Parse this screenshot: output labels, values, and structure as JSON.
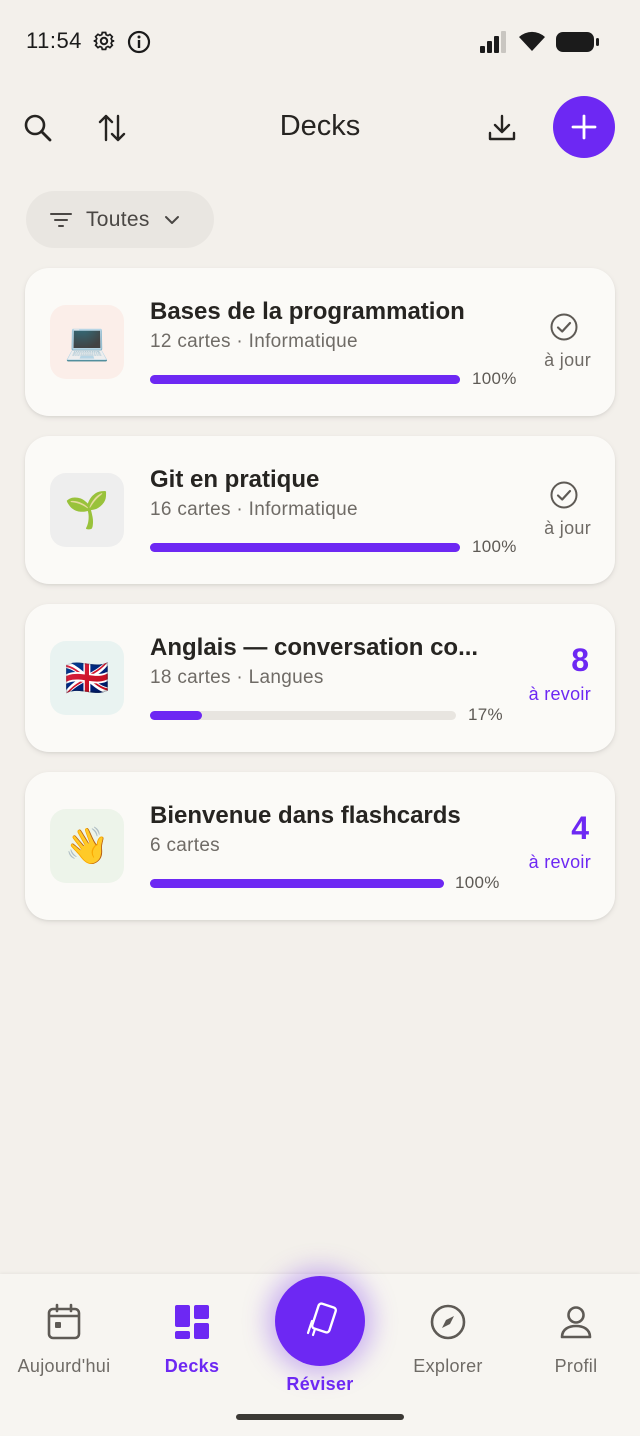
{
  "status_bar": {
    "time": "11:54"
  },
  "header": {
    "title": "Decks"
  },
  "filter": {
    "label": "Toutes"
  },
  "decks": [
    {
      "emoji": "💻",
      "emoji_bg": "#fbeee9",
      "title": "Bases de la programmation",
      "meta": "12 cartes · Informatique",
      "progress": 100,
      "progress_label": "100%",
      "status": "à jour",
      "due": null
    },
    {
      "emoji": "🌱",
      "emoji_bg": "#eeeeee",
      "title": "Git en pratique",
      "meta": "16 cartes · Informatique",
      "progress": 100,
      "progress_label": "100%",
      "status": "à jour",
      "due": null
    },
    {
      "emoji": "🇬🇧",
      "emoji_bg": "#e9f3f1",
      "title": "Anglais — conversation co...",
      "meta": "18 cartes · Langues",
      "progress": 17,
      "progress_label": "17%",
      "status": "à revoir",
      "due": "8"
    },
    {
      "emoji": "👋",
      "emoji_bg": "#edf4ea",
      "title": "Bienvenue dans flashcards",
      "meta": "6 cartes",
      "progress": 100,
      "progress_label": "100%",
      "status": "à revoir",
      "due": "4"
    }
  ],
  "nav": {
    "today": "Aujourd'hui",
    "decks": "Decks",
    "review": "Réviser",
    "explore": "Explorer",
    "profile": "Profil"
  },
  "colors": {
    "accent": "#6d28f3",
    "background": "#f3f0eb",
    "card": "#fbfaf7"
  }
}
